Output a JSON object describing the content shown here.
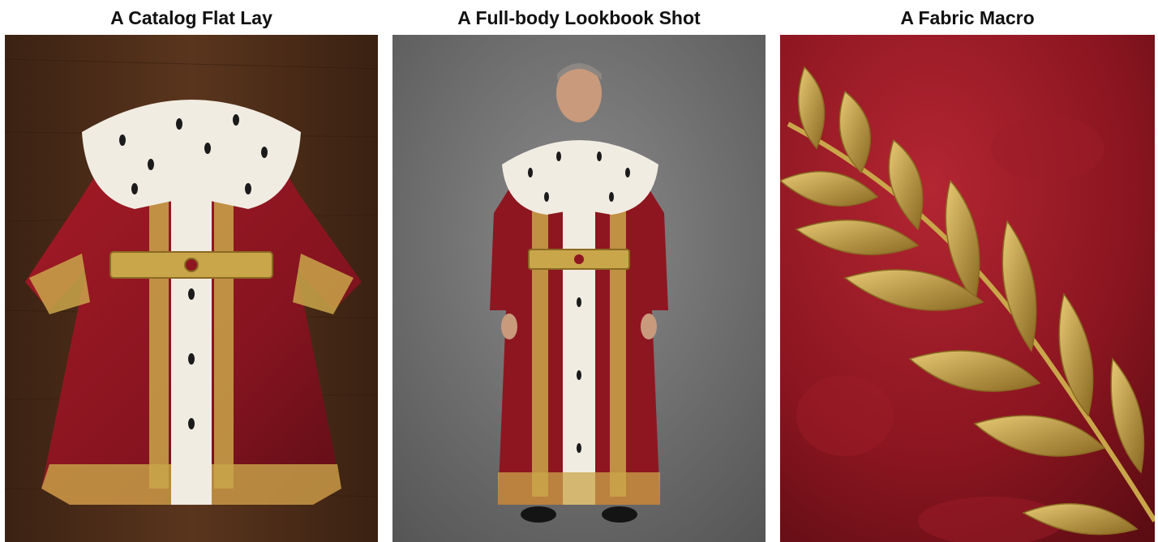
{
  "panels": [
    {
      "title": "A Catalog Flat Lay"
    },
    {
      "title": "A Full-body Lookbook Shot"
    },
    {
      "title": "A Fabric Macro"
    }
  ],
  "colors": {
    "robe_red": "#8e1620",
    "robe_dark": "#5a0c12",
    "gold": "#c9a64a",
    "gold_dark": "#8a6a22",
    "ermine": "#f1ece2",
    "wood": "#4a2a17",
    "studio_gray": "#6f6f70"
  },
  "icons": [
    "ermine-fur-collar",
    "gold-jeweled-belt",
    "laurel-embroidery"
  ]
}
